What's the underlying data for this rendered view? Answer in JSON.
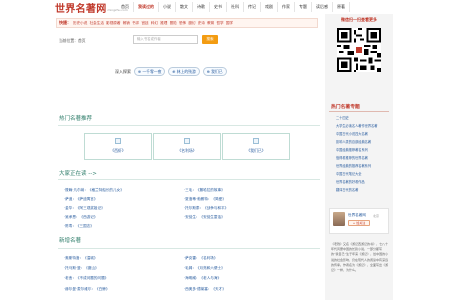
{
  "header": {
    "logo_text": "世界名著网",
    "logo_sub": "mingzhu.com",
    "nav": [
      {
        "label": "首页",
        "active": false
      },
      {
        "label": "我读过的",
        "active": true
      },
      {
        "label": "小说",
        "active": false
      },
      {
        "label": "散文",
        "active": false
      },
      {
        "label": "诗歌",
        "active": false
      },
      {
        "label": "史书",
        "active": false
      },
      {
        "label": "社科",
        "active": false
      },
      {
        "label": "传记",
        "active": false
      },
      {
        "label": "戏剧",
        "active": false
      },
      {
        "label": "作家",
        "active": false
      },
      {
        "label": "专题",
        "active": false
      },
      {
        "label": "读后感",
        "active": false
      },
      {
        "label": "原著",
        "active": false
      }
    ]
  },
  "quicklinks": {
    "title": "快捷：",
    "items": [
      "历史小说",
      "社会生活",
      "影视原著",
      "畅销",
      "书评",
      "宫廷",
      "科幻",
      "推理",
      "冒险",
      "恐怖",
      "魔幻",
      "史诗",
      "教育",
      "哲学",
      "国学"
    ]
  },
  "breadcrumb": "当前位置：首页",
  "search": {
    "placeholder": "输入书名或作者",
    "button_label": "搜索"
  },
  "deep_explore": {
    "label": "深入探索",
    "tags": [
      "⊕ 一千零一夜",
      "⊕ 林上的残游",
      "⊕ 我们已"
    ]
  },
  "sections": {
    "hot": "热门名著推荐",
    "popular": "大家正在读 -->",
    "new": "新增名著"
  },
  "recommended": [
    {
      "label": "《西虾》"
    },
    {
      "label": "《名利场》"
    },
    {
      "label": "《我们已》"
    }
  ],
  "popular_left": [
    "·筱翰·凡尔纳：《格兰特船长的儿女》",
    "·萨迪：《萨迪寓言》",
    "·金华：《阿三观奖姐记》",
    "·吴承恩：《西游记》",
    "·陈寿：《三国志》"
  ],
  "popular_right": [
    "·三毛：《撒哈拉的故事》",
    "·夏洛蒂·勃朗特：《简爱》",
    "·托尔斯泰：《战争与和平》",
    "·安徒生：《安徒生童话》"
  ],
  "new_left": [
    "·奥斯特洛：《温城》",
    "·托马斯·曼：《魔山》",
    "·老舍：《不成问题的问题》",
    "·赫尔曼·麦尔维尔：《白鲸》"
  ],
  "new_right": [
    "·萨克雷：《名利场》",
    "·毛姆：《月亮和六便士》",
    "·海明威：《老人与海》",
    "·西奥多·德莱塞：《天才》"
  ],
  "sidebar": {
    "wechat_title": "微信扫一扫查看更多",
    "hot_title": "热门名著专题",
    "hot_items": [
      "二十四史",
      "大学生必读名人著作世界名著",
      "中国古代小说四大名著",
      "影响人类的百部经典名著",
      "中国经典推荐著名系列",
      "值得看推荐的世界名著",
      "世界经典的推荐名著系列",
      "中国古代笔记大全",
      "世界名著的好看作品",
      "翻译古代的名著"
    ],
    "follow": {
      "name": "世界名著网",
      "location": "北京",
      "button": "+ 加关注"
    },
    "article": "《老残》又名《游记西游记的书》，七八十年代风靡中国的长篇小说，一部分都写的“我自己”生于年来《游记》，给中国的小说的社会影响，仍在现代人的阅读中有深远的传承。作者名为《游记》，全面写出《游记》一样，为什么。"
  },
  "colors": {
    "brand_red": "#c0392b",
    "link_blue": "#2a5d9f",
    "section_green": "#2e7d6a",
    "search_button": "#f39c12"
  }
}
